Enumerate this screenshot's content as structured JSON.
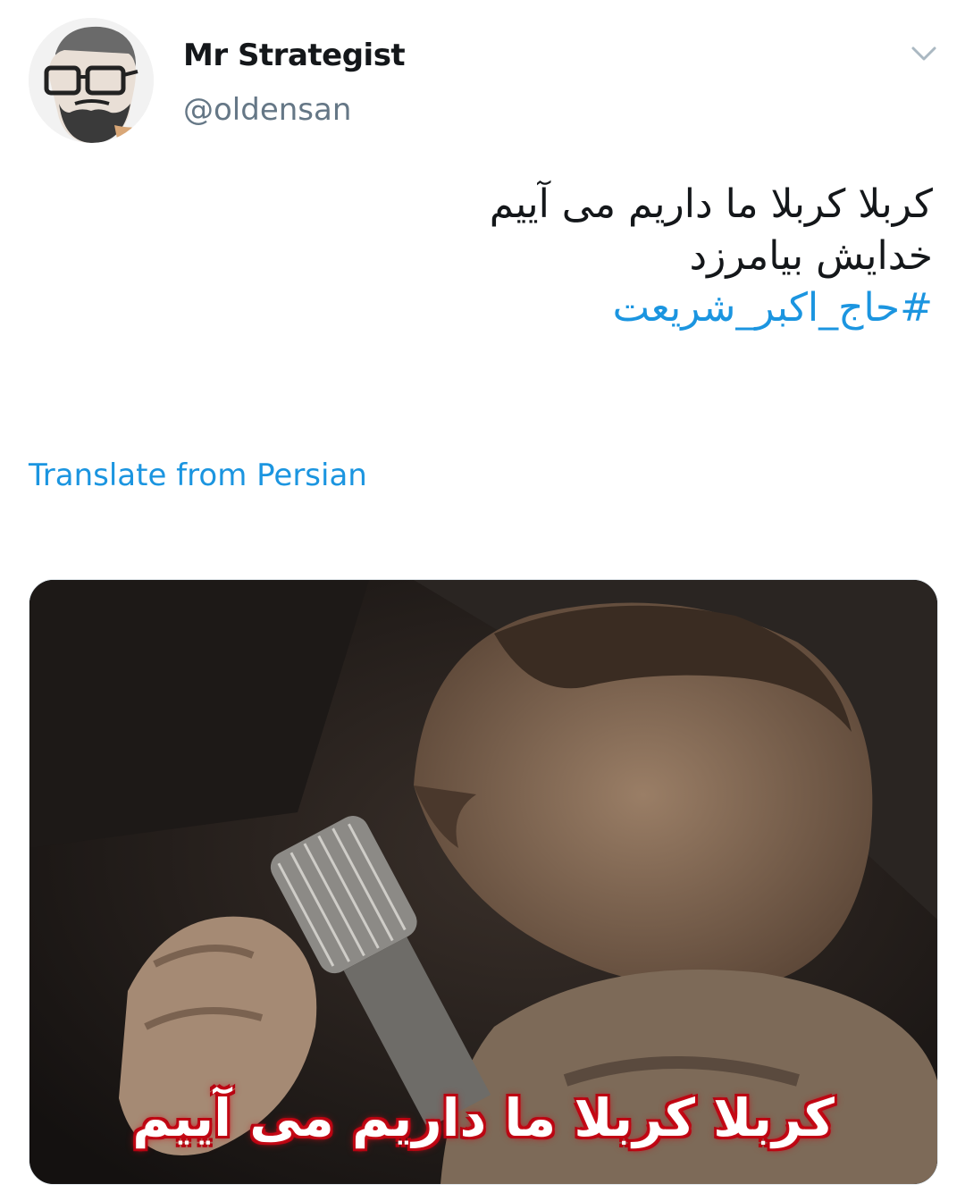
{
  "tweet": {
    "author": {
      "display_name": "Mr Strategist",
      "handle": "@oldensan",
      "avatar_icon": "bearded-man-portrait-icon"
    },
    "menu_icon": "chevron-down-icon",
    "text_lines": [
      "کربلا کربلا ما داریم می آییم",
      "خدایش بیامرزد"
    ],
    "hashtag": "#حاج_اکبر_شریعت",
    "translate_label": "Translate from Persian",
    "media": {
      "caption": "کربلا کربلا ما داریم می آییم"
    },
    "colors": {
      "link": "#1b95e0",
      "text": "#14171a",
      "secondary": "#657786",
      "caption_glow": "#d0101a"
    }
  }
}
